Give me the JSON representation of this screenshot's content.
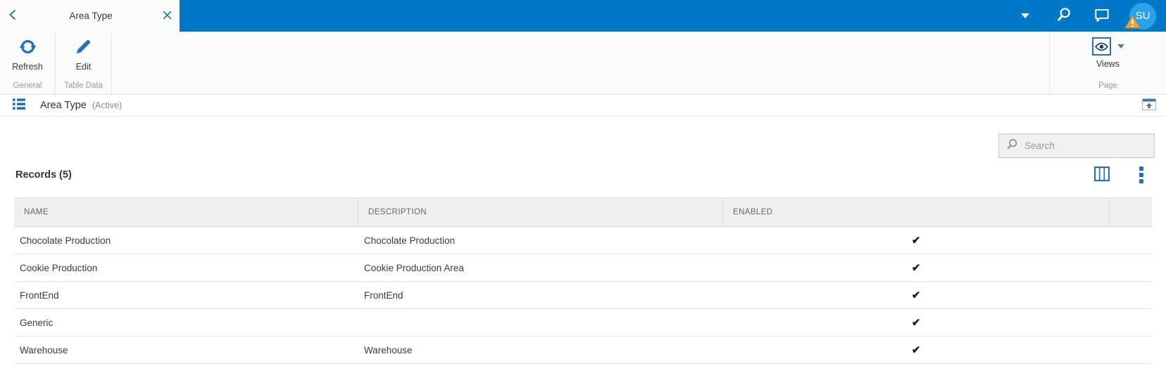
{
  "window": {
    "tab_title": "Area Type",
    "avatar_initials": "SU"
  },
  "ribbon": {
    "refresh_label": "Refresh",
    "edit_label": "Edit",
    "views_label": "Views",
    "group_general": "General",
    "group_table_data": "Table Data",
    "group_page": "Page"
  },
  "titlebar": {
    "title": "Area Type",
    "status": "(Active)"
  },
  "toolbar": {
    "search_placeholder": "Search",
    "records_heading": "Records (5)"
  },
  "table": {
    "columns": [
      "NAME",
      "DESCRIPTION",
      "ENABLED"
    ],
    "check_glyph": "✔",
    "rows": [
      {
        "name": "Chocolate Production",
        "description": "Chocolate Production",
        "enabled": true
      },
      {
        "name": "Cookie Production",
        "description": "Cookie Production Area",
        "enabled": true
      },
      {
        "name": "FrontEnd",
        "description": "FrontEnd",
        "enabled": true
      },
      {
        "name": "Generic",
        "description": "",
        "enabled": true
      },
      {
        "name": "Warehouse",
        "description": "Warehouse",
        "enabled": true
      }
    ]
  },
  "colors": {
    "topbar_blue": "#0078c8",
    "icon_blue": "#2272b5",
    "avatar_blue": "#28a2e9",
    "warning_orange": "#e5a33c"
  }
}
